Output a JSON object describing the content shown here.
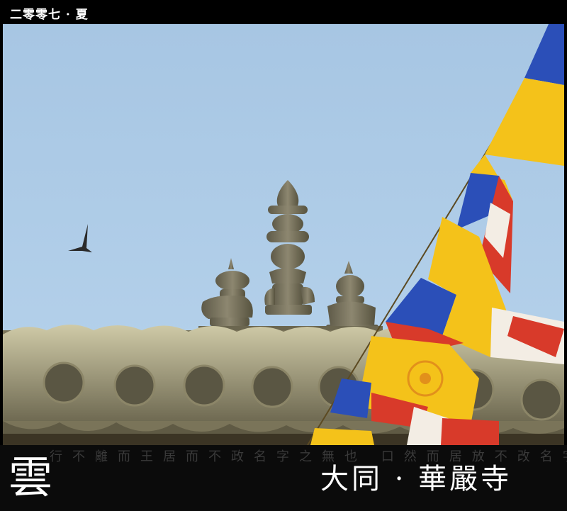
{
  "header": {
    "caption": "二零零七 · 夏"
  },
  "photo": {
    "subject": "temple-roof-ornaments",
    "colors": {
      "sky": "#a9c9e6",
      "stone": "#8a8468",
      "flag_yellow": "#f4c21a",
      "flag_blue": "#2b4fb8",
      "flag_red": "#d83a2a",
      "flag_white": "#f3ede4"
    }
  },
  "footer": {
    "big_char": "雲",
    "place": "大同 · 華嚴寺",
    "background_text": "行不離而王居而不政名字之無也  口然而居放不改名字之也口他"
  }
}
